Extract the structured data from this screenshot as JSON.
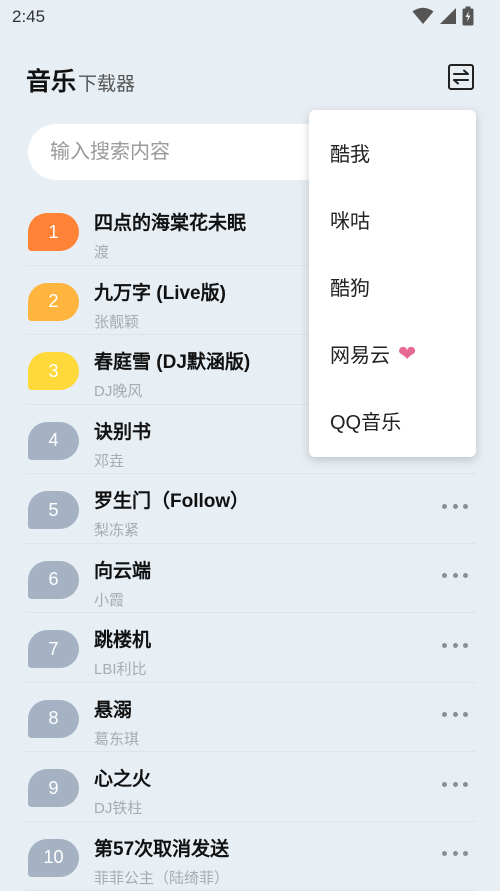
{
  "status_bar": {
    "time": "2:45",
    "icons": [
      "wifi-icon",
      "signal-icon",
      "battery-icon"
    ]
  },
  "header": {
    "title_main": "音乐",
    "title_sub": "下载器",
    "icon": "switch-icon"
  },
  "search": {
    "placeholder": "输入搜索内容",
    "value": ""
  },
  "colors": {
    "rank1": "#ff8236",
    "rank2": "#ffb53e",
    "rank3": "#ffd83a",
    "rank_default": "#a4b2c4",
    "heart": "#e46a94"
  },
  "songs": [
    {
      "rank": "1",
      "title": "四点的海棠花未眠",
      "artist": "渡"
    },
    {
      "rank": "2",
      "title": "九万字 (Live版)",
      "artist": "张靓颖"
    },
    {
      "rank": "3",
      "title": "春庭雪 (DJ默涵版)",
      "artist": "DJ晚风"
    },
    {
      "rank": "4",
      "title": "诀别书",
      "artist": "邓垚"
    },
    {
      "rank": "5",
      "title": "罗生门（Follow）",
      "artist": "梨冻紧"
    },
    {
      "rank": "6",
      "title": "向云端",
      "artist": "小霞"
    },
    {
      "rank": "7",
      "title": "跳楼机",
      "artist": "LBI利比"
    },
    {
      "rank": "8",
      "title": "悬溺",
      "artist": "葛东琪"
    },
    {
      "rank": "9",
      "title": "心之火",
      "artist": "DJ铁柱"
    },
    {
      "rank": "10",
      "title": "第57次取消发送",
      "artist": "菲菲公主（陆绮菲）"
    }
  ],
  "source_menu": {
    "items": [
      {
        "label": "酷我"
      },
      {
        "label": "咪咕"
      },
      {
        "label": "酷狗"
      },
      {
        "label": "网易云",
        "icon": "heart-icon"
      },
      {
        "label": "QQ音乐"
      }
    ]
  }
}
